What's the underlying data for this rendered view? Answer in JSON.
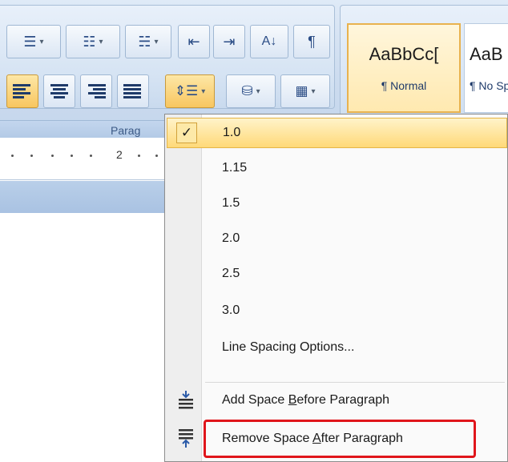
{
  "ribbon": {
    "paragraph_group_label": "Parag",
    "row1_buttons": [
      {
        "name": "bullets-button",
        "icon": "bullets-icon"
      },
      {
        "name": "numbering-button",
        "icon": "numbering-icon"
      },
      {
        "name": "multilevel-list-button",
        "icon": "multilevel-list-icon"
      },
      {
        "name": "decrease-indent-button",
        "icon": "decrease-indent-icon"
      },
      {
        "name": "increase-indent-button",
        "icon": "increase-indent-icon"
      },
      {
        "name": "sort-button",
        "icon": "sort-az-icon"
      },
      {
        "name": "show-formatting-button",
        "icon": "pilcrow-icon"
      }
    ],
    "row2_buttons": [
      {
        "name": "align-left-button",
        "icon": "align-left-icon",
        "active": true
      },
      {
        "name": "center-button",
        "icon": "align-center-icon"
      },
      {
        "name": "align-right-button",
        "icon": "align-right-icon"
      },
      {
        "name": "justify-button",
        "icon": "justify-icon"
      },
      {
        "name": "line-spacing-button",
        "icon": "line-spacing-icon",
        "active": true
      },
      {
        "name": "shading-button",
        "icon": "paint-bucket-icon"
      },
      {
        "name": "borders-button",
        "icon": "border-icon"
      }
    ],
    "styles": [
      {
        "preview": "AaBbCc[",
        "name": "¶ Normal",
        "selected": true
      },
      {
        "preview": "AaB",
        "name": "¶ No Sp",
        "selected": false
      }
    ]
  },
  "ruler": {
    "label": "2"
  },
  "menu": {
    "items": [
      {
        "label": "1.0",
        "checked": true,
        "highlighted": true
      },
      {
        "label": "1.15"
      },
      {
        "label": "1.5"
      },
      {
        "label": "2.0"
      },
      {
        "label": "2.5"
      },
      {
        "label": "3.0"
      },
      {
        "label": "Line Spacing Options..."
      }
    ],
    "add_space_before": {
      "prefix": "Add Space ",
      "accel": "B",
      "suffix": "efore Paragraph",
      "icon": "add-space-before-icon"
    },
    "remove_space_after": {
      "prefix": "Remove Space ",
      "accel": "A",
      "suffix": "fter Paragraph",
      "icon": "remove-space-after-icon"
    },
    "check_glyph": "✓"
  },
  "colors": {
    "highlight_box": "#e0151b",
    "menu_hover": "#ffd978",
    "ribbon_blue": "#cddcef"
  }
}
